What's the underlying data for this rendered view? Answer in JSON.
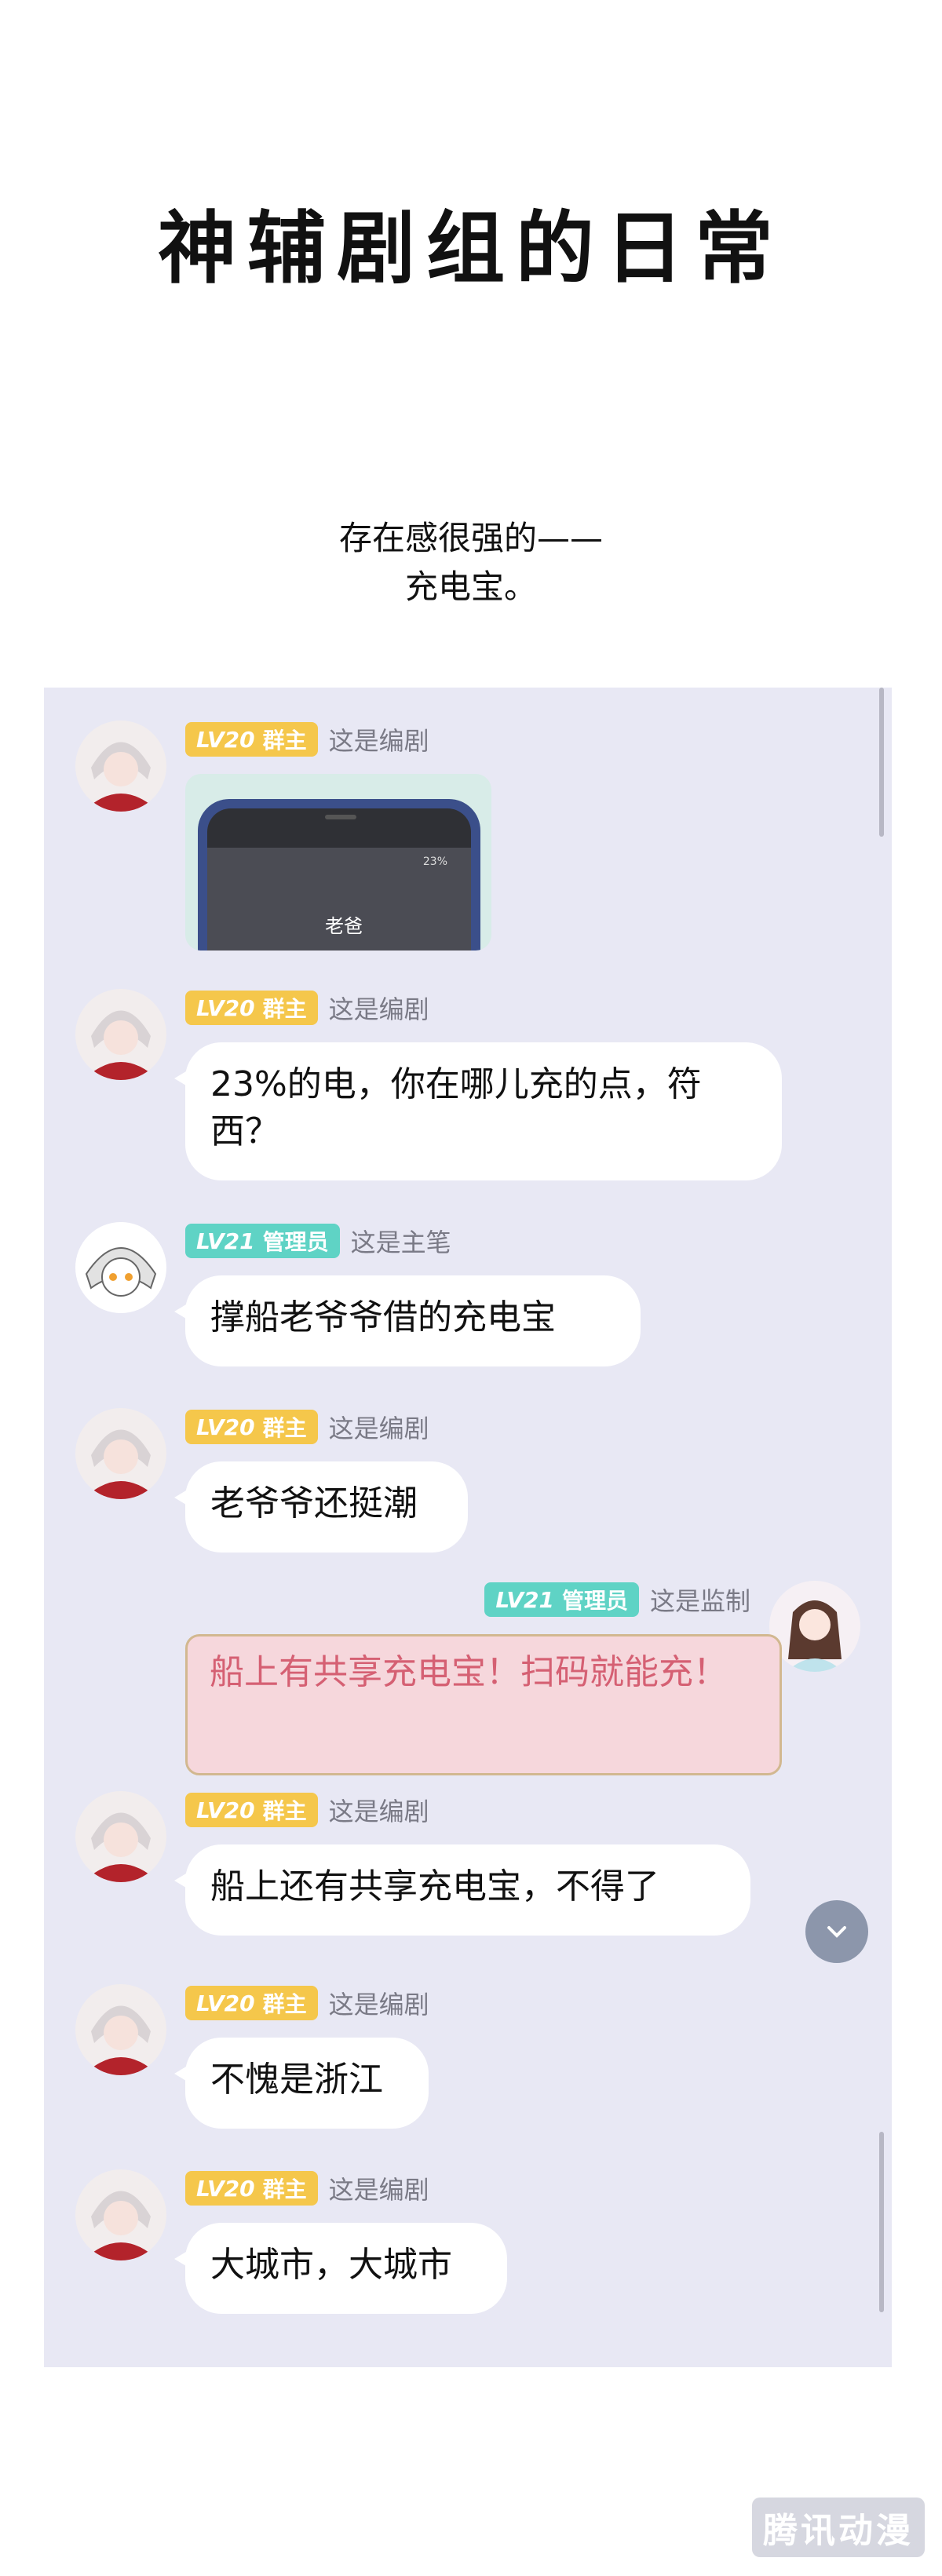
{
  "title": "神辅剧组的日常",
  "subtitle": [
    "存在感很强的——",
    "充电宝。"
  ],
  "badges": {
    "lv20": "LV20",
    "lv21": "LV21",
    "owner": "群主",
    "admin": "管理员"
  },
  "messages": [
    {
      "nick": "这是编剧",
      "image_text": "老爸",
      "image_status": "23%"
    },
    {
      "nick": "这是编剧",
      "text": "23%的电，你在哪儿充的点，符西？"
    },
    {
      "nick": "这是主笔",
      "text": "撑船老爷爷借的充电宝"
    },
    {
      "nick": "这是编剧",
      "text": "老爷爷还挺潮"
    },
    {
      "nick": "这是监制",
      "text": "船上有共享充电宝！扫码就能充！"
    },
    {
      "nick": "这是编剧",
      "text": "船上还有共享充电宝，不得了"
    },
    {
      "nick": "这是编剧",
      "text": "不愧是浙江"
    },
    {
      "nick": "这是编剧",
      "text": "大城市，大城市"
    }
  ],
  "watermark": "腾讯动漫",
  "colors": {
    "chat_bg": "#e8e8f4",
    "badge_gold": "#f5c74b",
    "badge_teal": "#5fd3c5",
    "pink_bubble": "#f6d7dc",
    "pink_text": "#d56073"
  }
}
